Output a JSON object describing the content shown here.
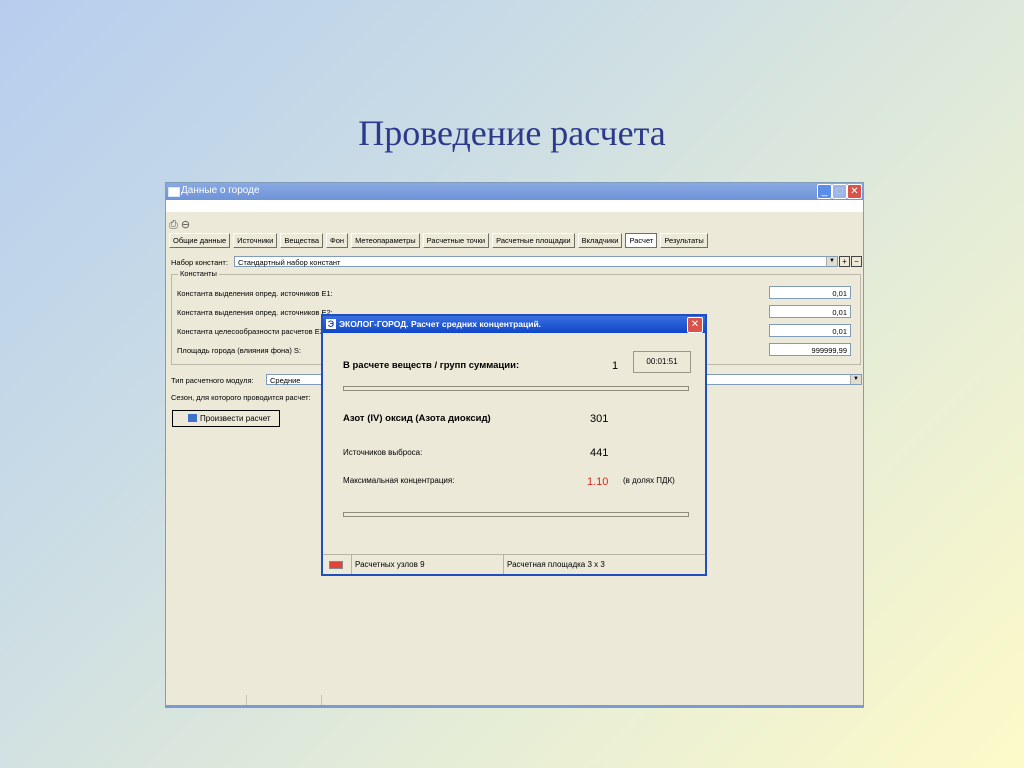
{
  "slide": {
    "title": "Проведение расчета"
  },
  "window": {
    "title": "Данные о городе",
    "tabs": [
      {
        "label": "Общие данные"
      },
      {
        "label": "Источники"
      },
      {
        "label": "Вещества"
      },
      {
        "label": "Фон"
      },
      {
        "label": "Метеопараметры"
      },
      {
        "label": "Расчетные точки"
      },
      {
        "label": "Расчетные площадки"
      },
      {
        "label": "Вкладчики"
      },
      {
        "label": "Расчет",
        "active": true
      },
      {
        "label": "Результаты"
      }
    ],
    "constants_set": {
      "label": "Набор констант:",
      "value": "Стандартный набор констант"
    },
    "constants_group": {
      "legend": "Константы",
      "rows": [
        {
          "label": "Константа выделения опред. источников Е1:",
          "value": "0,01"
        },
        {
          "label": "Константа выделения опред. источников Е2:",
          "value": "0,01"
        },
        {
          "label": "Константа целесообразности расчетов Е3:",
          "value": "0,01"
        },
        {
          "label": "Площадь города (влияния фона) S:",
          "value": "999999,99"
        }
      ]
    },
    "module_type": {
      "label": "Тип расчетного модуля:",
      "value": "Средние"
    },
    "season_label": "Сезон, для которого проводится расчет:",
    "calc_button": "Произвести расчет"
  },
  "dialog": {
    "title": "ЭКОЛОГ-ГОРОД. Расчет средних концентраций.",
    "substances_label": "В расчете веществ / групп суммации:",
    "substances_count": "1",
    "elapsed": "00:01:51",
    "substance_name": "Азот (IV) оксид (Азота диоксид)",
    "substance_code": "301",
    "sources_label": "Источников выброса:",
    "sources_count": "441",
    "max_conc_label": "Максимальная концентрация:",
    "max_conc_value": "1.10",
    "max_conc_unit": "(в долях ПДК)",
    "status": {
      "nodes": "Расчетных узлов 9",
      "area": "Расчетная площадка 3 x 3"
    }
  }
}
